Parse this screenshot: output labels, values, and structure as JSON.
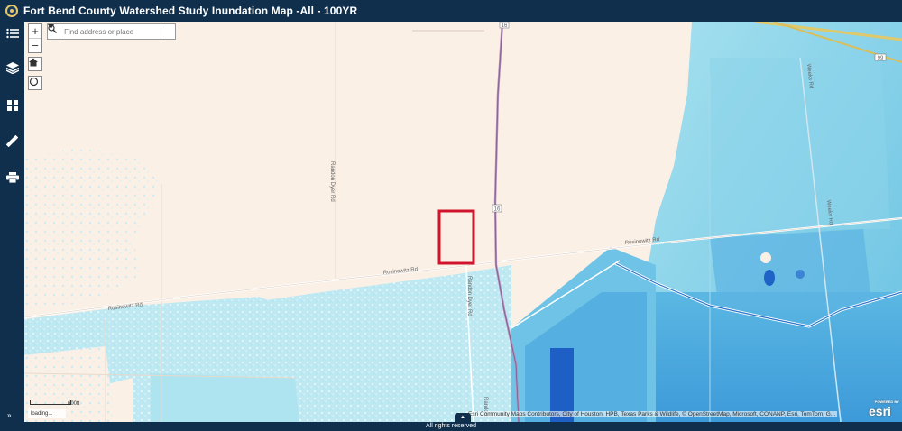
{
  "header": {
    "title": "Fort Bend County Watershed Study Inundation Map -All - 100YR"
  },
  "sidebar": {
    "items": [
      {
        "name": "legend",
        "icon": "legend-list-icon"
      },
      {
        "name": "layers",
        "icon": "layers-icon"
      },
      {
        "name": "basemap-gallery",
        "icon": "grid-icon"
      },
      {
        "name": "measurement",
        "icon": "ruler-icon"
      },
      {
        "name": "print",
        "icon": "printer-icon"
      }
    ],
    "expand_glyph": "»"
  },
  "map": {
    "zoom_in": "+",
    "zoom_out": "−",
    "search": {
      "placeholder": "Find address or place"
    },
    "scale_label": "600ft",
    "loading": "loading...",
    "attribution": "Esri Community Maps Contributors, City of Houston, HPB, Texas Parks & Wildlife, © OpenStreetMap, Microsoft, CONANP, Esri, TomTom, G...",
    "esri_logo": "esri",
    "esri_powered": "POWERED BY",
    "roads": {
      "rosinowitz_left": "Rosinowitz Rd",
      "rosinowitz_mid": "Rosinowitz Rd",
      "rosinowitz_right": "Rosinowitz Rd",
      "randon_dyer_north": "Randon Dyer Rd",
      "randon_dyer_south": "Randon Dyer Rd",
      "randon_bottom": "Randon",
      "weeks_rd": "Weeks Rd",
      "weeks_rd_2": "Weeks Rd",
      "hwy_16_top": "16",
      "hwy_16_mid": "16",
      "hwy_99": "99"
    },
    "colors": {
      "land": "#fbf0e6",
      "flood_light": "#bfe9f2",
      "flood_mid": "#7ccfe6",
      "flood_deep": "#3f8fd6",
      "highlight": "#d0142c"
    }
  },
  "footer": {
    "text": "All rights reserved",
    "toggle_glyph": "▲"
  }
}
